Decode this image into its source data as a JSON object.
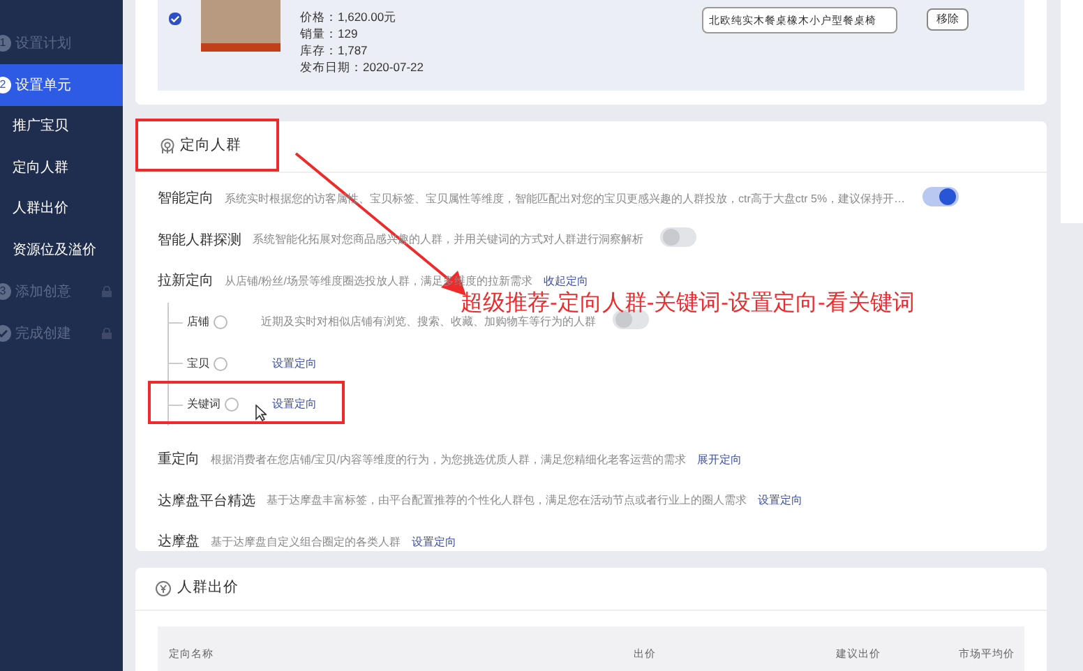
{
  "sidebar": {
    "steps": [
      {
        "kind": "number",
        "number": "1",
        "label": "设置计划",
        "selected": false,
        "locked": false
      },
      {
        "kind": "number",
        "number": "2",
        "label": "设置单元",
        "selected": true,
        "locked": false,
        "children": [
          {
            "label": "推广宝贝"
          },
          {
            "label": "定向人群"
          },
          {
            "label": "人群出价"
          },
          {
            "label": "资源位及溢价"
          }
        ]
      },
      {
        "kind": "number",
        "number": "3",
        "label": "添加创意",
        "selected": false,
        "locked": true
      },
      {
        "kind": "check",
        "label": "完成创建",
        "selected": false,
        "locked": true
      }
    ]
  },
  "product": {
    "checked": true,
    "details": [
      "价格：1,620.00元",
      "销量：129",
      "库存：1,787",
      "发布日期：2020-07-22"
    ],
    "title_value": "北欧纯实木餐桌橡木小户型餐桌椅",
    "remove_button": "移除"
  },
  "targeting": {
    "title": "定向人群",
    "rows": [
      {
        "label": "智能定向",
        "description": "系统实时根据您的访客属性、宝贝标签、宝贝属性等维度，智能匹配出对您的宝贝更感兴趣的人群投放，ctr高于大盘ctr 5%，建议保持开…",
        "kind": "toggle",
        "on": true
      },
      {
        "label": "智能人群探测",
        "description": "系统智能化拓展对您商品感兴趣的人群，并用关键词的方式对人群进行洞察解析",
        "kind": "toggle",
        "on": false
      },
      {
        "label": "拉新定向",
        "description": "从店铺/粉丝/场景等维度圈选投放人群，满足多维度的拉新需求",
        "kind": "link",
        "link": "收起定向",
        "children": [
          {
            "label": "店铺",
            "description": "近期及实时对相似店铺有浏览、搜索、收藏、加购物车等行为的人群",
            "kind": "toggle",
            "on": false
          },
          {
            "label": "宝贝",
            "kind": "link",
            "link": "设置定向"
          },
          {
            "label": "关键词",
            "kind": "link",
            "link": "设置定向"
          }
        ]
      },
      {
        "label": "重定向",
        "description": "根据消费者在您店铺/宝贝/内容等维度的行为，为您挑选优质人群，满足您精细化老客运营的需求",
        "kind": "link",
        "link": "展开定向"
      },
      {
        "label": "达摩盘平台精选",
        "description": "基于达摩盘丰富标签，由平台配置推荐的个性化人群包，满足您在活动节点或者行业上的圈人需求",
        "kind": "link",
        "link": "设置定向"
      },
      {
        "label": "达摩盘",
        "description": "基于达摩盘自定义组合圈定的各类人群",
        "kind": "link",
        "link": "设置定向"
      }
    ]
  },
  "annotation": {
    "text": "超级推荐-定向人群-关键词-设置定向-看关键词"
  },
  "bidding": {
    "title": "人群出价",
    "columns": [
      "定向名称",
      "出价",
      "建议出价",
      "市场平均价"
    ]
  }
}
